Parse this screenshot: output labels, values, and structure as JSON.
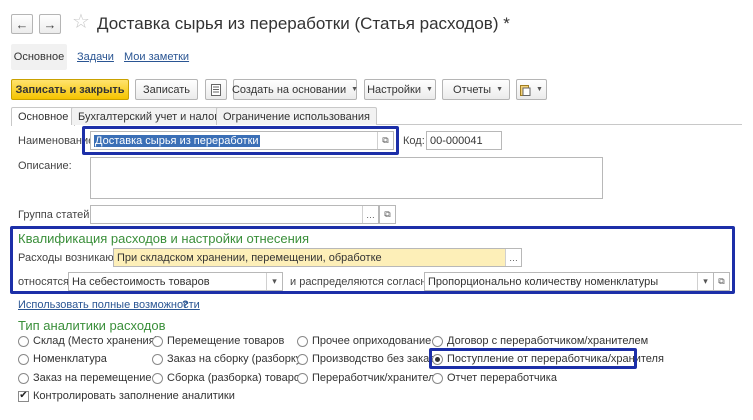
{
  "window": {
    "title": "Доставка сырья из переработки (Статья расходов) *",
    "back_icon": "←",
    "forward_icon": "→",
    "star_icon": "☆"
  },
  "topnav": {
    "main": "Основное",
    "tasks": "Задачи",
    "notes": "Мои заметки"
  },
  "toolbar": {
    "save_close": "Записать и закрыть",
    "save": "Записать",
    "create_based": "Создать на основании",
    "settings": "Настройки",
    "reports": "Отчеты"
  },
  "tabs": [
    "Основное",
    "Бухгалтерский учет и налоги",
    "Ограничение использования"
  ],
  "form": {
    "name_label": "Наименование:",
    "name_value": "Доставка сырья из переработки",
    "code_label": "Код:",
    "code_value": "00-000041",
    "description_label": "Описание:",
    "description_value": "",
    "group_label": "Группа статей:",
    "group_value": ""
  },
  "qualification": {
    "title": "Квалификация расходов и настройки отнесения",
    "arises_label": "Расходы возникают:",
    "arises_value": "При складском хранении, перемещении, обработке",
    "assigned_label": "относятся:",
    "assigned_value": "На себестоимость товаров",
    "distributed_label": "и распределяются согласно:",
    "distributed_value": "Пропорционально количеству номенклатуры"
  },
  "full_features_link": "Использовать полные возможности",
  "help_mark": "?",
  "analytics": {
    "title": "Тип аналитики расходов",
    "options": [
      [
        "Склад (Место хранения)",
        "Перемещение товаров",
        "Прочее оприходование",
        "Договор с переработчиком/хранителем"
      ],
      [
        "Номенклатура",
        "Заказ на сборку (разборку)",
        "Производство без заказа",
        "Поступление от переработчика/хранителя"
      ],
      [
        "Заказ на перемещение",
        "Сборка (разборка) товаров",
        "Переработчик/хранитель",
        "Отчет переработчика"
      ]
    ],
    "selected": "Поступление от переработчика/хранителя",
    "control_label": "Контролировать заполнение аналитики",
    "control_checked": true
  },
  "colors": {
    "accent_green": "#3a8f3a",
    "highlight_blue": "#1c2fa8",
    "primary_button": "#f5c400",
    "field_yellow": "#fdefb8"
  }
}
